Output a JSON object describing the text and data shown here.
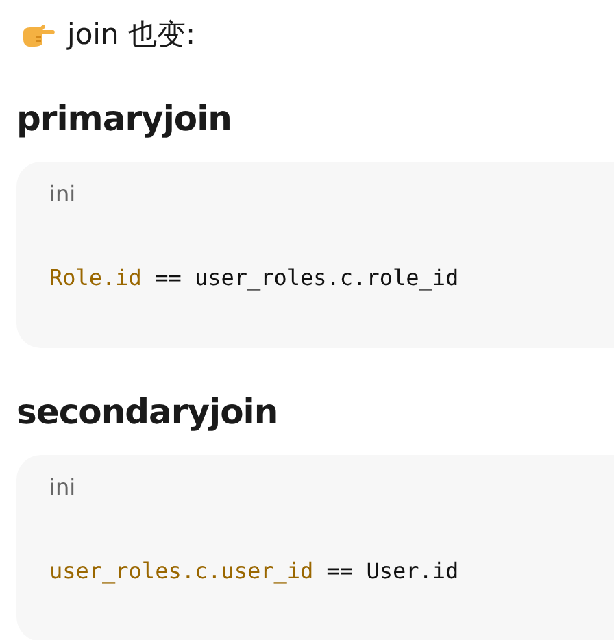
{
  "intro": {
    "text": "join 也变:"
  },
  "sections": [
    {
      "heading": "primaryjoin",
      "code_block": {
        "language": "ini",
        "tokens": [
          {
            "text": "Role.id",
            "kind": "key"
          },
          {
            "text": " == user_roles.c.role_id",
            "kind": "plain"
          }
        ]
      }
    },
    {
      "heading": "secondaryjoin",
      "code_block": {
        "language": "ini",
        "tokens": [
          {
            "text": "user_roles.c.user_id",
            "kind": "key"
          },
          {
            "text": " == User.id",
            "kind": "plain"
          }
        ]
      }
    }
  ]
}
